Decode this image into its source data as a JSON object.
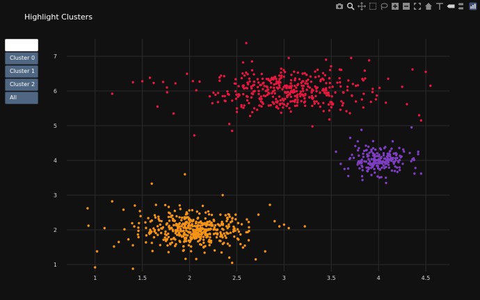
{
  "page": {
    "background": "#111111",
    "plot_background": "#111111"
  },
  "modebar": {
    "icons": [
      "camera-icon",
      "zoom-icon",
      "pan-icon",
      "box-select-icon",
      "lasso-select-icon",
      "zoom-in-icon",
      "zoom-out-icon",
      "autoscale-icon",
      "reset-axes-icon",
      "spike-lines-icon",
      "hover-closest-icon",
      "hover-compare-icon",
      "plotly-logo-icon"
    ],
    "icon_color": "#8a8a8a"
  },
  "menu": {
    "buttons": [
      {
        "label": "",
        "active": true
      },
      {
        "label": "Cluster 0",
        "active": false
      },
      {
        "label": "Cluster 1",
        "active": false
      },
      {
        "label": "Cluster 2",
        "active": false
      },
      {
        "label": "All",
        "active": false
      }
    ]
  },
  "chart_data": {
    "type": "scatter",
    "title": "Highlight Clusters",
    "xlabel": "",
    "ylabel": "",
    "xlim": [
      0.7,
      4.75
    ],
    "ylim": [
      0.8,
      7.5
    ],
    "xticks": [
      1,
      1.5,
      2,
      2.5,
      3,
      3.5,
      4,
      4.5
    ],
    "xtick_labels": [
      "1",
      "1.5",
      "2",
      "2.5",
      "3",
      "3.5",
      "4",
      "4.5"
    ],
    "yticks": [
      1,
      2,
      3,
      4,
      5,
      6,
      7
    ],
    "ytick_labels": [
      "1",
      "2",
      "3",
      "4",
      "5",
      "6",
      "7"
    ],
    "grid": true,
    "grid_color": "#2c2c2c",
    "tick_color": "#d9d9d9",
    "legend": "none",
    "series": [
      {
        "color": "#e8173f",
        "center": [
          3.05,
          6.0
        ],
        "spread": [
          0.55,
          0.42
        ],
        "count": 400,
        "points": [
          [
            1.18,
            5.92
          ],
          [
            1.4,
            6.25
          ],
          [
            1.5,
            6.28
          ],
          [
            1.58,
            6.38
          ],
          [
            1.62,
            6.23
          ],
          [
            1.66,
            5.55
          ],
          [
            1.72,
            6.26
          ],
          [
            1.76,
            6.1
          ],
          [
            1.83,
            5.35
          ],
          [
            1.85,
            6.22
          ],
          [
            2.05,
            4.72
          ],
          [
            2.3,
            5.68
          ],
          [
            2.42,
            5.05
          ],
          [
            2.45,
            4.85
          ],
          [
            2.6,
            7.38
          ],
          [
            2.66,
            6.85
          ],
          [
            3.05,
            6.95
          ],
          [
            3.3,
            4.98
          ],
          [
            3.48,
            5.18
          ],
          [
            3.71,
            6.95
          ],
          [
            3.9,
            6.88
          ],
          [
            4.25,
            6.12
          ],
          [
            4.3,
            5.62
          ],
          [
            4.36,
            6.62
          ],
          [
            4.43,
            5.3
          ],
          [
            4.45,
            5.15
          ],
          [
            4.5,
            6.55
          ],
          [
            4.55,
            6.15
          ]
        ]
      },
      {
        "color": "#7e3ec2",
        "center": [
          4.0,
          4.0
        ],
        "spread": [
          0.2,
          0.26
        ],
        "count": 210,
        "points": [
          [
            3.55,
            4.25
          ],
          [
            3.6,
            3.9
          ],
          [
            3.68,
            3.55
          ],
          [
            3.7,
            4.65
          ],
          [
            3.78,
            4.55
          ],
          [
            3.82,
            4.88
          ],
          [
            4.08,
            3.35
          ],
          [
            4.15,
            4.55
          ],
          [
            4.35,
            4.95
          ],
          [
            4.38,
            3.62
          ],
          [
            4.42,
            4.25
          ],
          [
            4.45,
            3.62
          ]
        ]
      },
      {
        "color": "#f59315",
        "center": [
          2.05,
          2.0
        ],
        "spread": [
          0.38,
          0.35
        ],
        "count": 470,
        "points": [
          [
            0.92,
            2.62
          ],
          [
            0.93,
            2.12
          ],
          [
            1.0,
            0.92
          ],
          [
            1.02,
            1.38
          ],
          [
            1.1,
            2.05
          ],
          [
            1.18,
            2.82
          ],
          [
            1.2,
            1.52
          ],
          [
            1.25,
            1.65
          ],
          [
            1.3,
            2.58
          ],
          [
            1.4,
            0.88
          ],
          [
            1.42,
            2.7
          ],
          [
            1.6,
            3.33
          ],
          [
            1.95,
            3.6
          ],
          [
            2.35,
            3.0
          ],
          [
            2.42,
            1.2
          ],
          [
            2.45,
            1.05
          ],
          [
            2.7,
            1.15
          ],
          [
            2.8,
            1.38
          ],
          [
            2.85,
            2.72
          ],
          [
            2.9,
            2.25
          ],
          [
            2.95,
            2.1
          ],
          [
            3.0,
            2.15
          ],
          [
            3.05,
            2.05
          ],
          [
            3.22,
            2.1
          ]
        ]
      }
    ]
  }
}
